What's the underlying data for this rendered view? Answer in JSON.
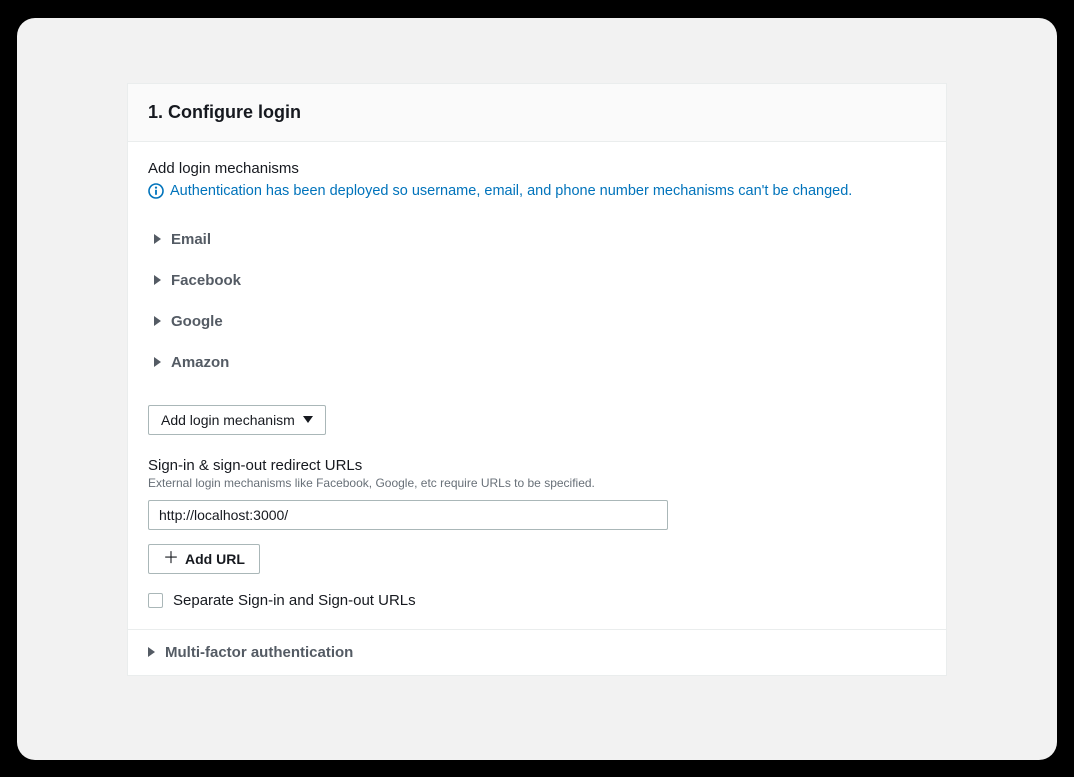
{
  "header": {
    "title": "1. Configure login"
  },
  "login_section": {
    "subtitle": "Add login mechanisms",
    "info_message": "Authentication has been deployed so username, email, and phone number mechanisms can't be changed.",
    "mechanisms": [
      {
        "label": "Email"
      },
      {
        "label": "Facebook"
      },
      {
        "label": "Google"
      },
      {
        "label": "Amazon"
      }
    ],
    "add_mechanism_label": "Add login mechanism"
  },
  "redirect_section": {
    "label": "Sign-in & sign-out redirect URLs",
    "helper": "External login mechanisms like Facebook, Google, etc require URLs to be specified.",
    "url_value": "http://localhost:3000/",
    "add_url_label": "Add URL",
    "separate_urls_label": "Separate Sign-in and Sign-out URLs"
  },
  "mfa_section": {
    "label": "Multi-factor authentication"
  },
  "colors": {
    "link_info": "#0073bb",
    "text_primary": "#16191f",
    "text_secondary": "#545b64",
    "border": "#aab7b8"
  }
}
